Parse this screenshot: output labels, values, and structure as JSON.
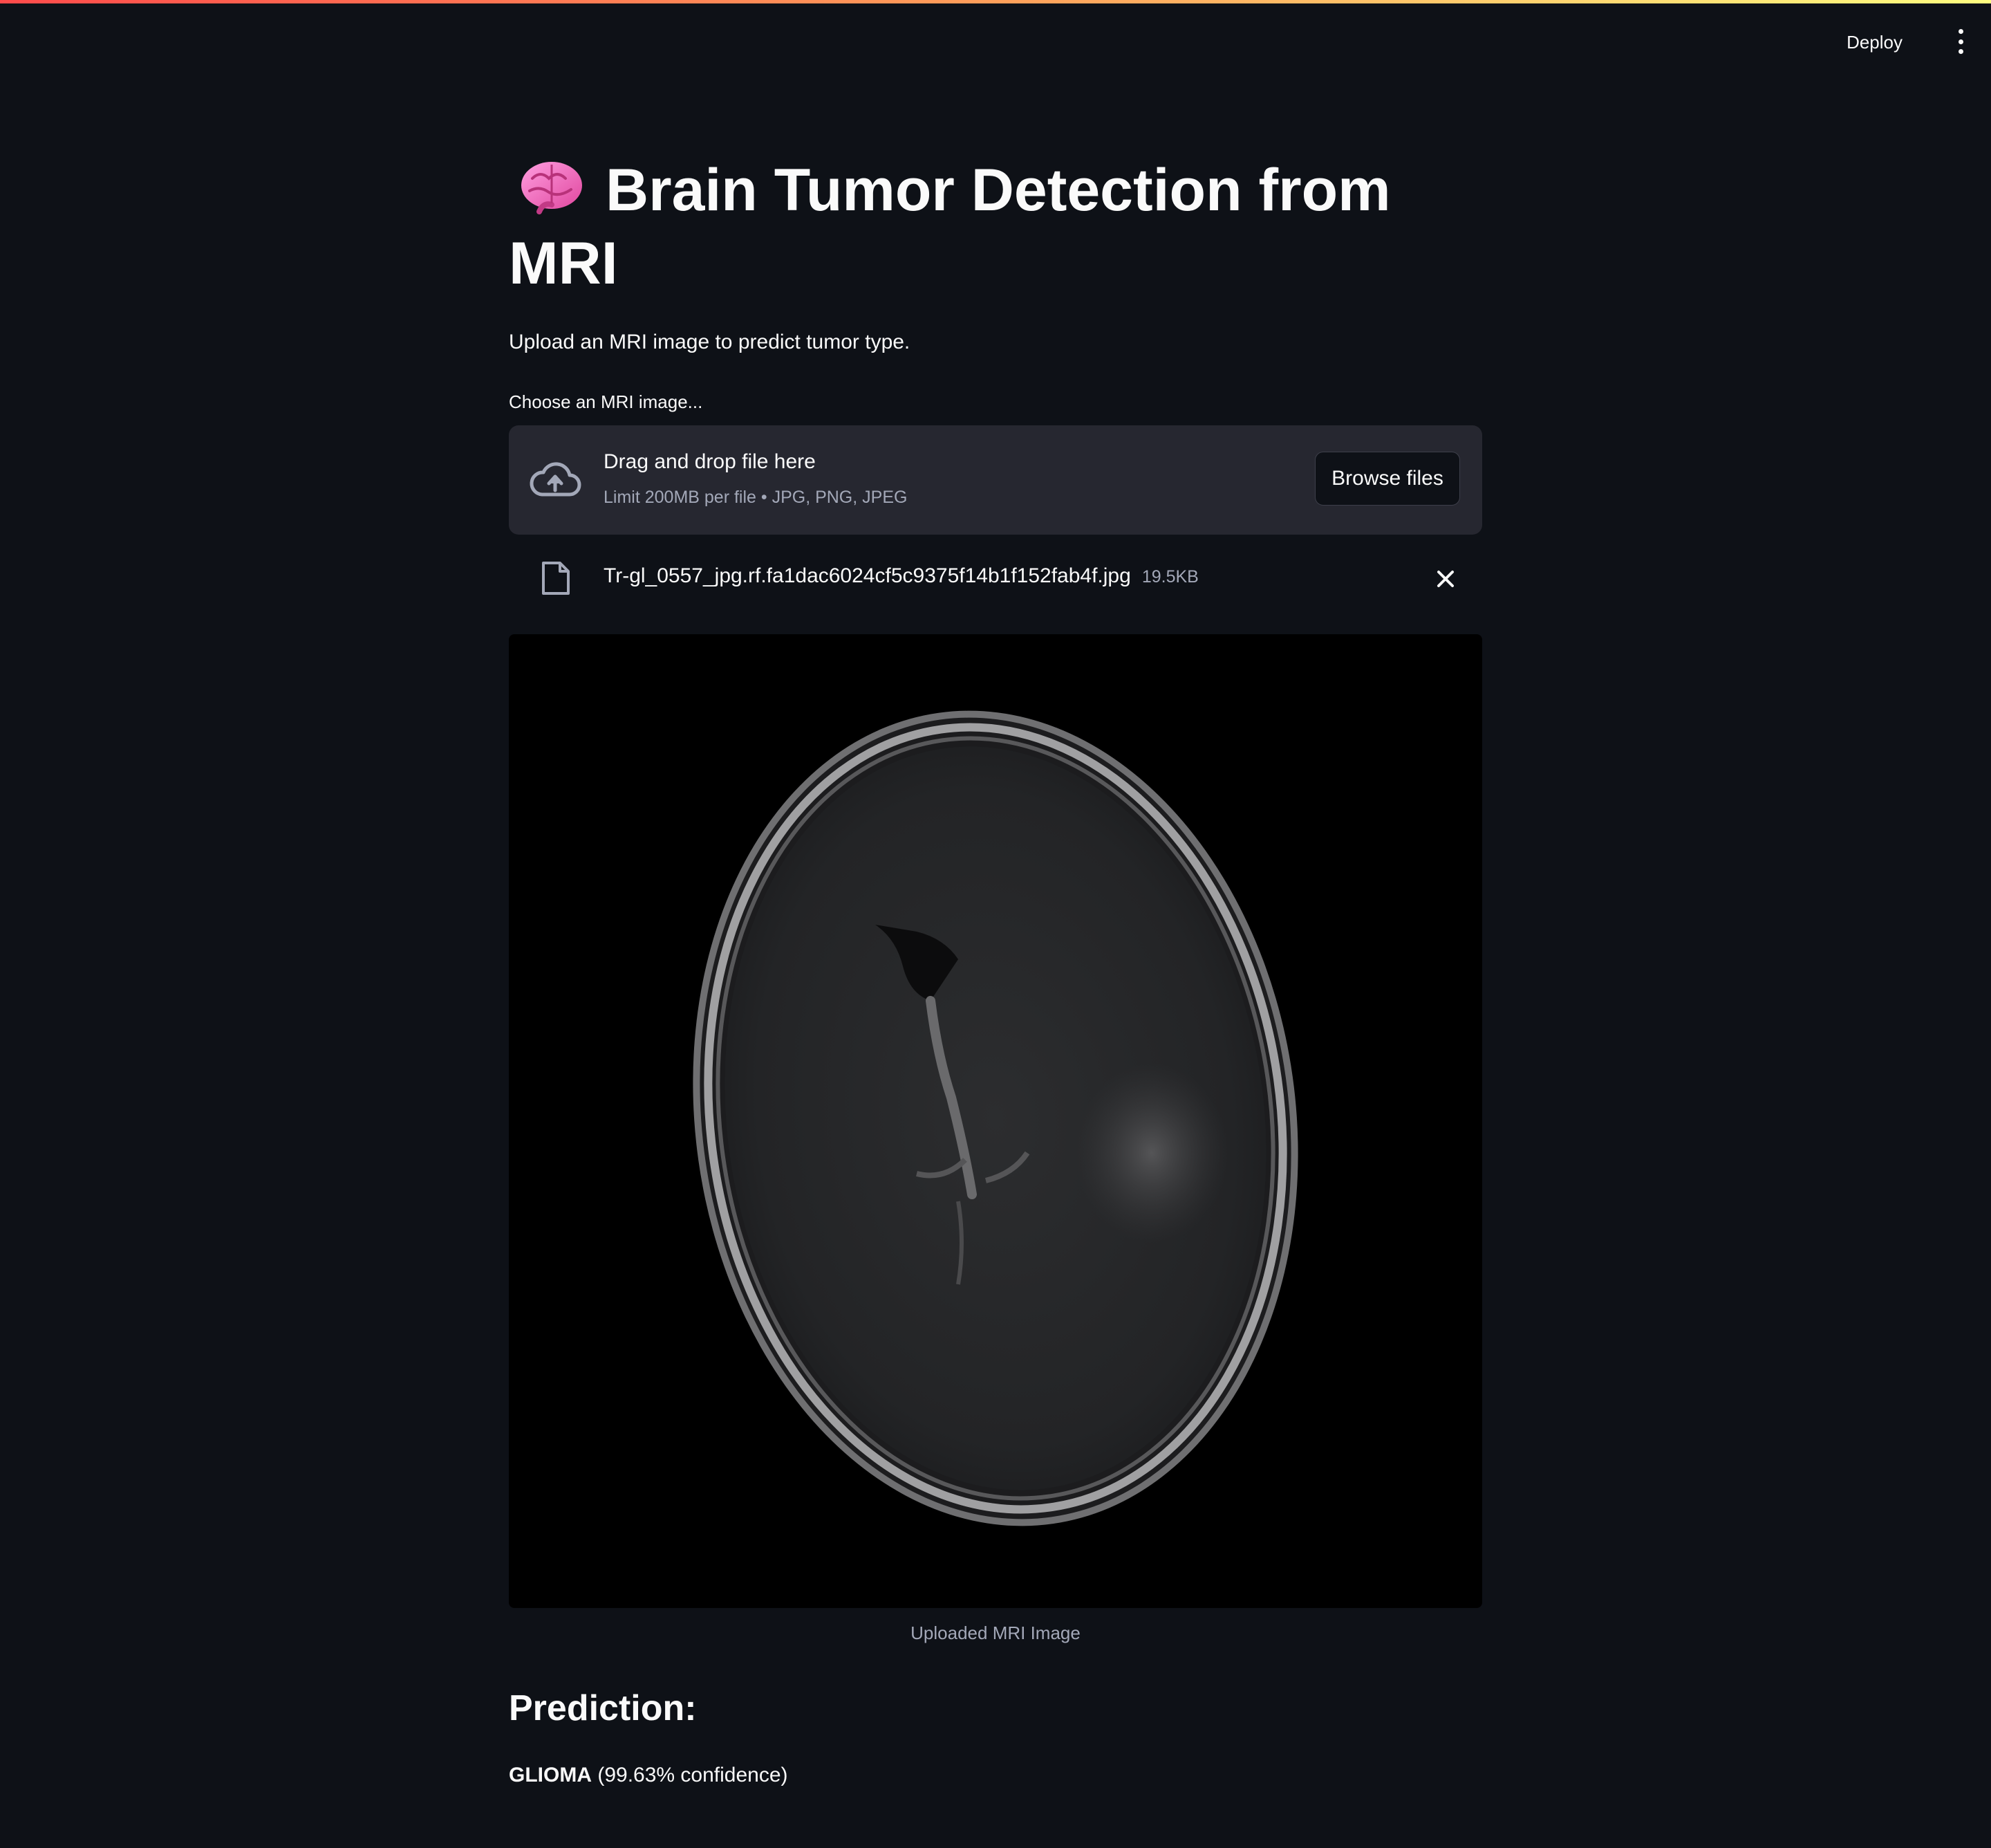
{
  "header": {
    "deploy_label": "Deploy",
    "menu_icon": "vertical-dots-icon"
  },
  "colors": {
    "background": "#0e1117",
    "surface": "#262730",
    "text": "#fafafa",
    "muted_text": "#a3a8b8",
    "accent_gradient": [
      "#ff4b4b",
      "#fffd80"
    ]
  },
  "page": {
    "title_icon": "brain-icon",
    "title": "Brain Tumor Detection from MRI",
    "subtitle": "Upload an MRI image to predict tumor type."
  },
  "uploader": {
    "label": "Choose an MRI image...",
    "drop_title": "Drag and drop file here",
    "drop_limit": "Limit 200MB per file • JPG, PNG, JPEG",
    "browse_label": "Browse files",
    "icon": "cloud-upload-icon"
  },
  "uploaded_file": {
    "name": "Tr-gl_0557_jpg.rf.fa1dac6024cf5c9375f14b1f152fab4f.jpg",
    "size": "19.5KB",
    "icon": "file-icon",
    "remove_icon": "close-icon"
  },
  "image": {
    "caption": "Uploaded MRI Image"
  },
  "prediction": {
    "heading": "Prediction:",
    "label": "GLIOMA",
    "confidence_text": "(99.63% confidence)"
  }
}
